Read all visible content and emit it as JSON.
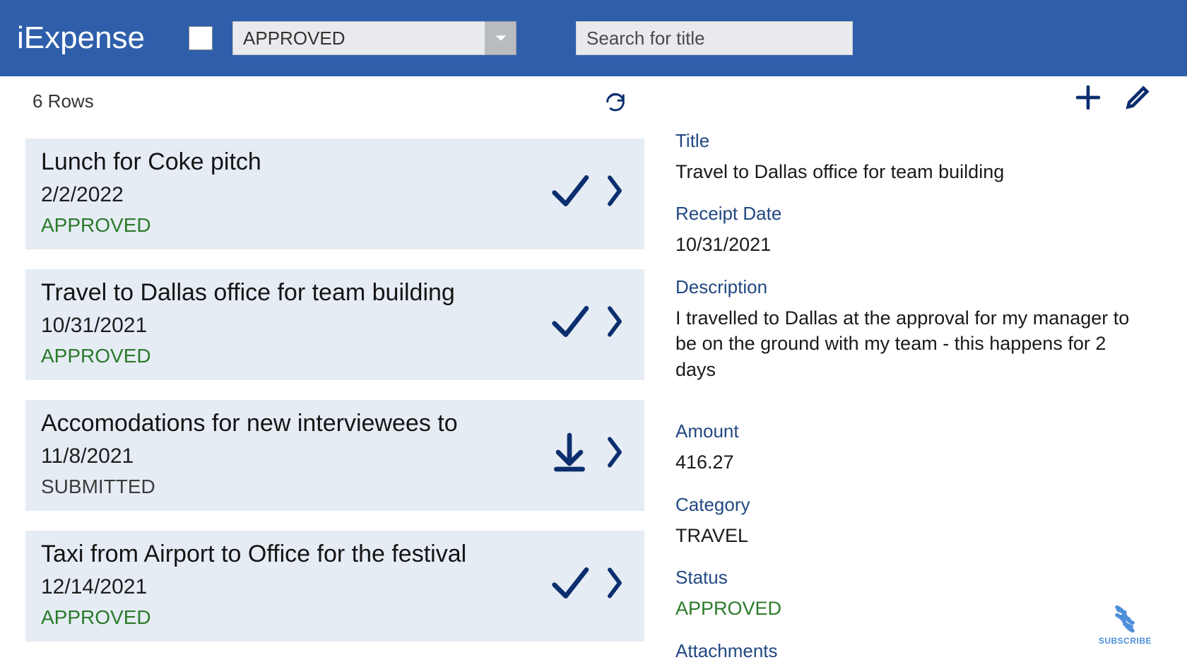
{
  "header": {
    "app_title": "iExpense",
    "status_filter": "APPROVED",
    "search_placeholder": "Search for title",
    "checkbox_checked": false
  },
  "list": {
    "row_count_label": "6 Rows",
    "items": [
      {
        "title": "Lunch for Coke pitch",
        "date": "2/2/2022",
        "status": "APPROVED",
        "icon": "check"
      },
      {
        "title": "Travel to Dallas office for team building",
        "date": "10/31/2021",
        "status": "APPROVED",
        "icon": "check"
      },
      {
        "title": "Accomodations for new interviewees to",
        "date": "11/8/2021",
        "status": "SUBMITTED",
        "icon": "download"
      },
      {
        "title": "Taxi from Airport to Office for the festival",
        "date": "12/14/2021",
        "status": "APPROVED",
        "icon": "check"
      }
    ]
  },
  "detail": {
    "labels": {
      "title": "Title",
      "receipt_date": "Receipt Date",
      "description": "Description",
      "amount": "Amount",
      "category": "Category",
      "status": "Status",
      "attachments": "Attachments"
    },
    "values": {
      "title": "Travel to Dallas office for team building",
      "receipt_date": "10/31/2021",
      "description": "I travelled to Dallas at the approval for my manager to be on the ground with my team - this happens for 2 days",
      "amount": "416.27",
      "category": "TRAVEL",
      "status": "APPROVED"
    }
  },
  "subscribe_label": "SUBSCRIBE"
}
